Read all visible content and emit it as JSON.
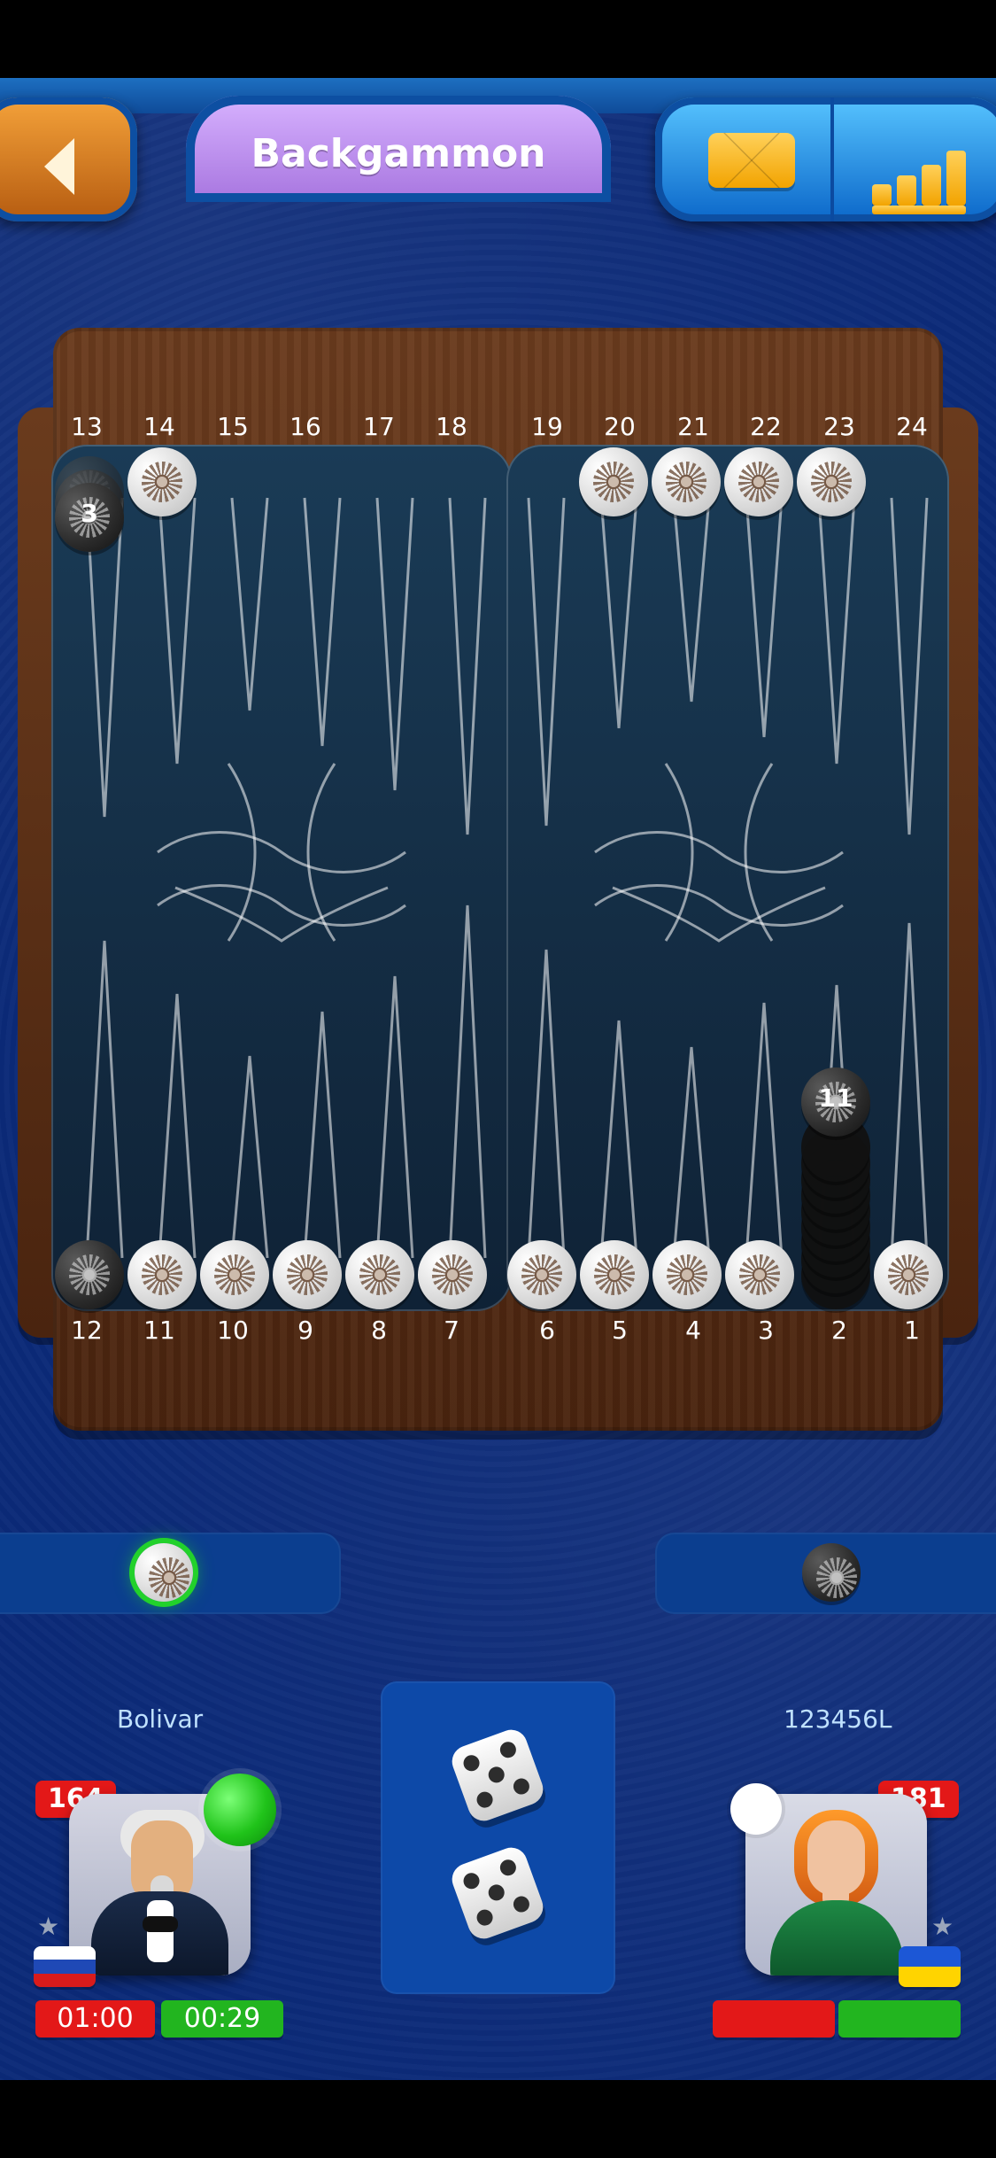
{
  "header": {
    "title": "Backgammon",
    "icons": [
      "back-chevron-icon",
      "mail-icon",
      "stats-icon"
    ]
  },
  "board": {
    "top_numbers": [
      "13",
      "14",
      "15",
      "16",
      "17",
      "18",
      "19",
      "20",
      "21",
      "22",
      "23",
      "24"
    ],
    "bottom_numbers": [
      "12",
      "11",
      "10",
      "9",
      "8",
      "7",
      "6",
      "5",
      "4",
      "3",
      "2",
      "1"
    ],
    "counts": {
      "point13_black": "3",
      "point2_black": "11"
    }
  },
  "players": {
    "left": {
      "name": "Bolivar",
      "rating": "164",
      "timer_total": "01:00",
      "timer_turn": "00:29"
    },
    "right": {
      "name": "123456L",
      "rating": "181"
    }
  },
  "dice": {
    "die1_icon": "die-three-icon",
    "die2_icon": "die-three-icon"
  },
  "colors": {
    "accent_green": "#22b51f",
    "accent_red": "#e31818",
    "title_purple": "#a775df",
    "header_blue": "#0b67c9"
  }
}
